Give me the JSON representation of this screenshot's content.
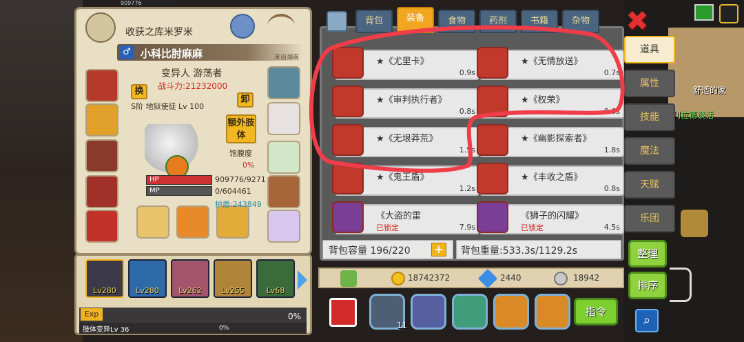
{
  "character": {
    "title": "收获之库米罗米",
    "name": "小科比肘麻麻",
    "gender_symbol": "♂",
    "origin": "来自湖南",
    "class": "变异人 游荡者",
    "power": "战斗力:21232000",
    "rank": "S阶 地狱使徒 Lv 100",
    "swap_label": "换",
    "unload_label": "卸",
    "extra_limb_label": "额外肢体",
    "satiety_label": "饱腹度",
    "satiety_value": "0%",
    "hp_label": "HP",
    "mp_label": "MP",
    "hp_value": "909776/9271",
    "mp_value": "0/604461",
    "shield_value": "护盾:243849",
    "top_hp_fragment": "909776"
  },
  "team": [
    {
      "level": "Lv280"
    },
    {
      "level": "Lv280"
    },
    {
      "level": "Lv262"
    },
    {
      "level": "Lv255"
    },
    {
      "level": "Lv68"
    }
  ],
  "exp": {
    "label": "Exp",
    "percent": "0%",
    "limb_label": "肢体变异Lv 36",
    "limb_percent": "0%"
  },
  "bag": {
    "tabs": [
      "背包",
      "装备",
      "食物",
      "药剂",
      "书籍",
      "杂物"
    ],
    "active_tab": "装备",
    "items": [
      {
        "name": "★《尤里卡》",
        "weight": "0.9s",
        "color": "#c0392b"
      },
      {
        "name": "★《无情放送》",
        "weight": "0.7s",
        "color": "#c0392b"
      },
      {
        "name": "★《审判执行者》",
        "weight": "0.8s",
        "color": "#c0392b"
      },
      {
        "name": "★《权荣》",
        "weight": "0.6s",
        "color": "#c0392b"
      },
      {
        "name": "★《无垠莽荒》",
        "weight": "1.5s",
        "color": "#c0392b"
      },
      {
        "name": "★《幽影探索者》",
        "weight": "1.8s",
        "color": "#c0392b"
      },
      {
        "name": "★《鬼王盾》",
        "weight": "1.2s",
        "color": "#c0392b"
      },
      {
        "name": "★《丰收之盾》",
        "weight": "0.8s",
        "color": "#c0392b"
      },
      {
        "name": "《大盗的雷",
        "weight": "7.9s",
        "lock": "已锁定",
        "color": "#7a3e96"
      },
      {
        "name": "《狮子的闪耀》",
        "weight": "4.5s",
        "lock": "已锁定",
        "color": "#7a3e96"
      }
    ],
    "capacity": "背包容量 196/220",
    "weight": "背包重量:533.3s/1129.2s",
    "gold": "18742372",
    "diamond": "2440",
    "silver": "18942",
    "action_badge": "11",
    "command_label": "指令"
  },
  "side_nav": [
    "道具",
    "属性",
    "技能",
    "魔法",
    "天赋",
    "乐团"
  ],
  "side_active": "道具",
  "buttons": {
    "organize": "整理",
    "sort": "排序"
  },
  "scene": {
    "room_label": "舒适的家",
    "npc_label": "墓人利拉德谈话"
  },
  "colors": {
    "accent": "#f2a51e",
    "highlight_stroke": "#f03d4a",
    "panel_bg": "#e9dfc5"
  }
}
